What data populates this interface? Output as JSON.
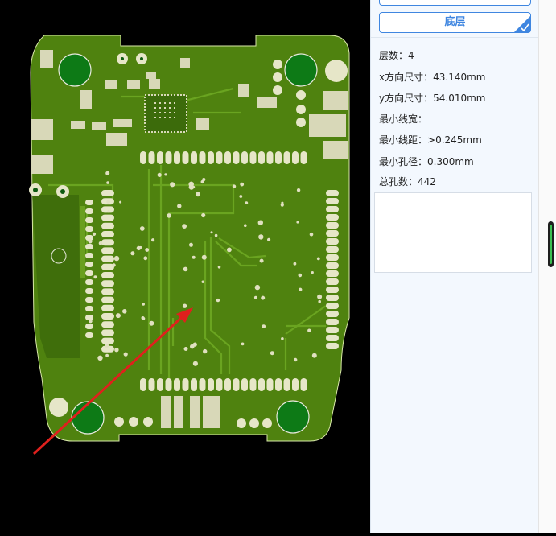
{
  "panel": {
    "layer_button": "底层",
    "info": [
      {
        "label": "层数：",
        "value": "4"
      },
      {
        "label": "x方向尺寸：",
        "value": "43.140mm"
      },
      {
        "label": "y方向尺寸：",
        "value": "54.010mm"
      },
      {
        "label": "最小线宽：",
        "value": ""
      },
      {
        "label": "最小线距：",
        "value": ">0.245mm"
      },
      {
        "label": "最小孔径：",
        "value": "0.300mm"
      },
      {
        "label": "总孔数：",
        "value": "442"
      }
    ],
    "notes_text": ""
  },
  "colors": {
    "board": "#4f820f",
    "board_dark": "#3f6e0b",
    "trace": "#61991a",
    "pad": "#d8d8b8",
    "pad_white": "#e9e9df",
    "hole_green": "#0d7a16",
    "arrow": "#e0201d",
    "accent": "#3f86e0"
  },
  "icons": {
    "check": "check-icon"
  }
}
